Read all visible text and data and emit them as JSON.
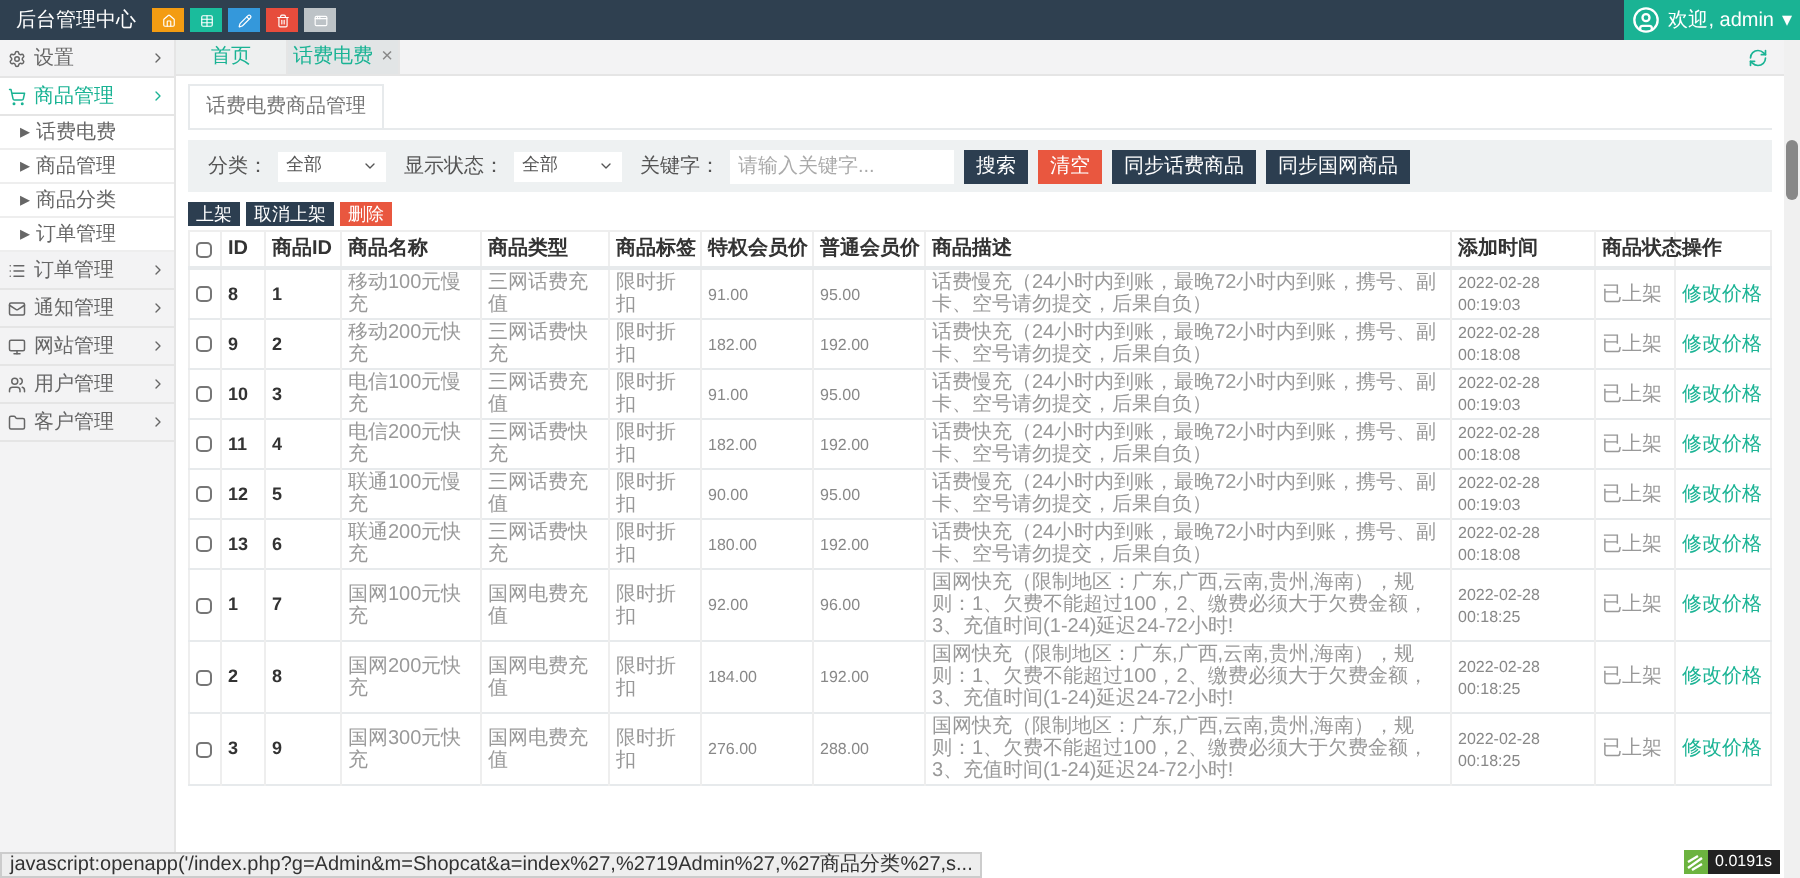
{
  "header": {
    "title": "后台管理中心",
    "user": "欢迎, admin",
    "caret": "▾",
    "quick_buttons": [
      {
        "kind": "home",
        "color": "#f39c12"
      },
      {
        "kind": "table",
        "color": "#1abc9c"
      },
      {
        "kind": "edit",
        "color": "#3498db"
      },
      {
        "kind": "delete",
        "color": "#e74c3c"
      },
      {
        "kind": "window",
        "color": "#bdc3c7"
      }
    ]
  },
  "sidebar": {
    "items": [
      {
        "label": "设置",
        "selected": false
      },
      {
        "label": "商品管理",
        "selected": true,
        "children": [
          {
            "label": "话费电费"
          },
          {
            "label": "商品管理"
          },
          {
            "label": "商品分类"
          },
          {
            "label": "订单管理"
          }
        ]
      },
      {
        "label": "订单管理",
        "selected": false
      },
      {
        "label": "通知管理",
        "selected": false
      },
      {
        "label": "网站管理",
        "selected": false
      },
      {
        "label": "用户管理",
        "selected": false
      },
      {
        "label": "客户管理",
        "selected": false
      }
    ],
    "sub_bullet": "▸"
  },
  "tabs": [
    {
      "label": "首页",
      "selected": false,
      "closable": false
    },
    {
      "label": "话费电费",
      "selected": true,
      "closable": true
    }
  ],
  "tab_close": "×",
  "panel_tab": "话费电费商品管理",
  "filters": {
    "category_label": "分类：",
    "category_value": "全部",
    "status_label": "显示状态：",
    "status_value": "全部",
    "keyword_label": "关键字：",
    "keyword_placeholder": "请输入关键字...",
    "buttons": [
      {
        "label": "搜索",
        "kind": "dark"
      },
      {
        "label": "清空",
        "kind": "danger"
      },
      {
        "label": "同步话费商品",
        "kind": "dark"
      },
      {
        "label": "同步国网商品",
        "kind": "dark"
      }
    ]
  },
  "bulk_actions": [
    {
      "label": "上架",
      "kind": "dark"
    },
    {
      "label": "取消上架",
      "kind": "dark"
    },
    {
      "label": "删除",
      "kind": "danger"
    }
  ],
  "table": {
    "select_all_checked": false,
    "columns": [
      "ID",
      "商品ID",
      "商品名称",
      "商品类型",
      "商品标签",
      "特权会员价",
      "普通会员价",
      "商品描述",
      "添加时间",
      "商品状态",
      "操作"
    ],
    "rows": [
      {
        "checked": false,
        "cells": [
          "8",
          "1",
          "移动100元慢充",
          "三网话费充值",
          "限时折扣",
          "91.00",
          "95.00",
          "话费慢充（24小时内到账，最晚72小时内到账，携号、副卡、空号请勿提交，后果自负）",
          "2022-02-28 00:19:03",
          "已上架",
          "修改价格"
        ]
      },
      {
        "checked": false,
        "cells": [
          "9",
          "2",
          "移动200元快充",
          "三网话费快充",
          "限时折扣",
          "182.00",
          "192.00",
          "话费快充（24小时内到账，最晚72小时内到账，携号、副卡、空号请勿提交，后果自负）",
          "2022-02-28 00:18:08",
          "已上架",
          "修改价格"
        ]
      },
      {
        "checked": false,
        "cells": [
          "10",
          "3",
          "电信100元慢充",
          "三网话费充值",
          "限时折扣",
          "91.00",
          "95.00",
          "话费慢充（24小时内到账，最晚72小时内到账，携号、副卡、空号请勿提交，后果自负）",
          "2022-02-28 00:19:03",
          "已上架",
          "修改价格"
        ]
      },
      {
        "checked": false,
        "cells": [
          "11",
          "4",
          "电信200元快充",
          "三网话费快充",
          "限时折扣",
          "182.00",
          "192.00",
          "话费快充（24小时内到账，最晚72小时内到账，携号、副卡、空号请勿提交，后果自负）",
          "2022-02-28 00:18:08",
          "已上架",
          "修改价格"
        ]
      },
      {
        "checked": false,
        "cells": [
          "12",
          "5",
          "联通100元慢充",
          "三网话费充值",
          "限时折扣",
          "90.00",
          "95.00",
          "话费慢充（24小时内到账，最晚72小时内到账，携号、副卡、空号请勿提交，后果自负）",
          "2022-02-28 00:19:03",
          "已上架",
          "修改价格"
        ]
      },
      {
        "checked": false,
        "cells": [
          "13",
          "6",
          "联通200元快充",
          "三网话费快充",
          "限时折扣",
          "180.00",
          "192.00",
          "话费快充（24小时内到账，最晚72小时内到账，携号、副卡、空号请勿提交，后果自负）",
          "2022-02-28 00:18:08",
          "已上架",
          "修改价格"
        ]
      },
      {
        "checked": false,
        "cells": [
          "1",
          "7",
          "国网100元快充",
          "国网电费充值",
          "限时折扣",
          "92.00",
          "96.00",
          "国网快充（限制地区：广东,广西,云南,贵州,海南），规则：1、欠费不能超过100，2、缴费必须大于欠费金额，3、充值时间(1-24)延迟24-72小时!",
          "2022-02-28 00:18:25",
          "已上架",
          "修改价格"
        ]
      },
      {
        "checked": false,
        "cells": [
          "2",
          "8",
          "国网200元快充",
          "国网电费充值",
          "限时折扣",
          "184.00",
          "192.00",
          "国网快充（限制地区：广东,广西,云南,贵州,海南），规则：1、欠费不能超过100，2、缴费必须大于欠费金额，3、充值时间(1-24)延迟24-72小时!",
          "2022-02-28 00:18:25",
          "已上架",
          "修改价格"
        ]
      },
      {
        "checked": false,
        "cells": [
          "3",
          "9",
          "国网300元快充",
          "国网电费充值",
          "限时折扣",
          "276.00",
          "288.00",
          "国网快充（限制地区：广东,广西,云南,贵州,海南），规则：1、欠费不能超过100，2、缴费必须大于欠费金额，3、充值时间(1-24)延迟24-72小时!",
          "2022-02-28 00:18:25",
          "已上架",
          "修改价格"
        ]
      }
    ]
  },
  "status_bar": "javascript:openapp('/index.php?g=Admin&m=Shopcat&a=index%27,%2719Admin%27,%27商品分类%27,s...",
  "timer_badge": "0.0191s"
}
